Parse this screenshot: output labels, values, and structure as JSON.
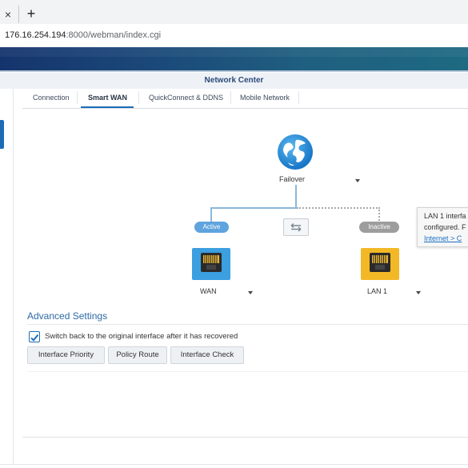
{
  "browser": {
    "close_icon_glyph": "×",
    "new_tab_glyph": "+",
    "url_host": "176.16.254.194",
    "url_rest": ":8000/webman/index.cgi"
  },
  "window": {
    "title": "Network Center"
  },
  "tabs": [
    {
      "label": "Connection"
    },
    {
      "label": "Smart WAN"
    },
    {
      "label": "QuickConnect & DDNS"
    },
    {
      "label": "Mobile Network"
    }
  ],
  "diagram": {
    "mode_label": "Failover",
    "active_pill": "Active",
    "inactive_pill": "Inactive",
    "wan_label": "WAN",
    "lan_label": "LAN 1",
    "tooltip": {
      "line1": "LAN 1 interfa",
      "line2": "configured. F",
      "link": "Internet > C"
    }
  },
  "advanced": {
    "title": "Advanced Settings",
    "switch_back_label": "Switch back to the original interface after it has recovered",
    "switch_back_checked": true,
    "buttons": [
      "Interface Priority",
      "Policy Route",
      "Interface Check"
    ]
  },
  "colors": {
    "accent": "#1c6cb5",
    "active_pill": "#5fa4de",
    "inactive_pill": "#9d9d9d",
    "wan_port": "#3c9fe0",
    "lan_port": "#f2b826"
  }
}
